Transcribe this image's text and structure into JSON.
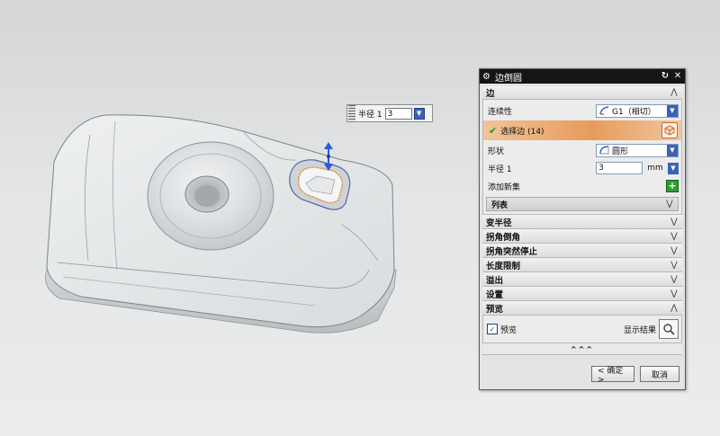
{
  "float_input": {
    "label": "半径 1",
    "value": "3"
  },
  "dialog": {
    "title": "边倒圆",
    "edge_section": {
      "title": "边",
      "continuity_label": "连续性",
      "continuity_value": "G1（相切）",
      "select_label": "选择边 (14)",
      "shape_label": "形状",
      "shape_value": "圆形",
      "radius_label": "半径 1",
      "radius_value": "3",
      "radius_unit": "mm",
      "add_set_label": "添加新集",
      "list_label": "列表"
    },
    "collapsed_sections": [
      "变半径",
      "拐角倒角",
      "拐角突然停止",
      "长度限制",
      "溢出",
      "设置"
    ],
    "preview_section": {
      "title": "预览",
      "checkbox_label": "预览",
      "checked": true,
      "show_result_label": "显示结果"
    },
    "more_bar": "^^^",
    "ok_label": "< 确定 >",
    "cancel_label": "取消"
  },
  "colors": {
    "accent_orange": "#e79b5a",
    "spin_blue": "#3a63b5",
    "titlebar": "#151515"
  }
}
